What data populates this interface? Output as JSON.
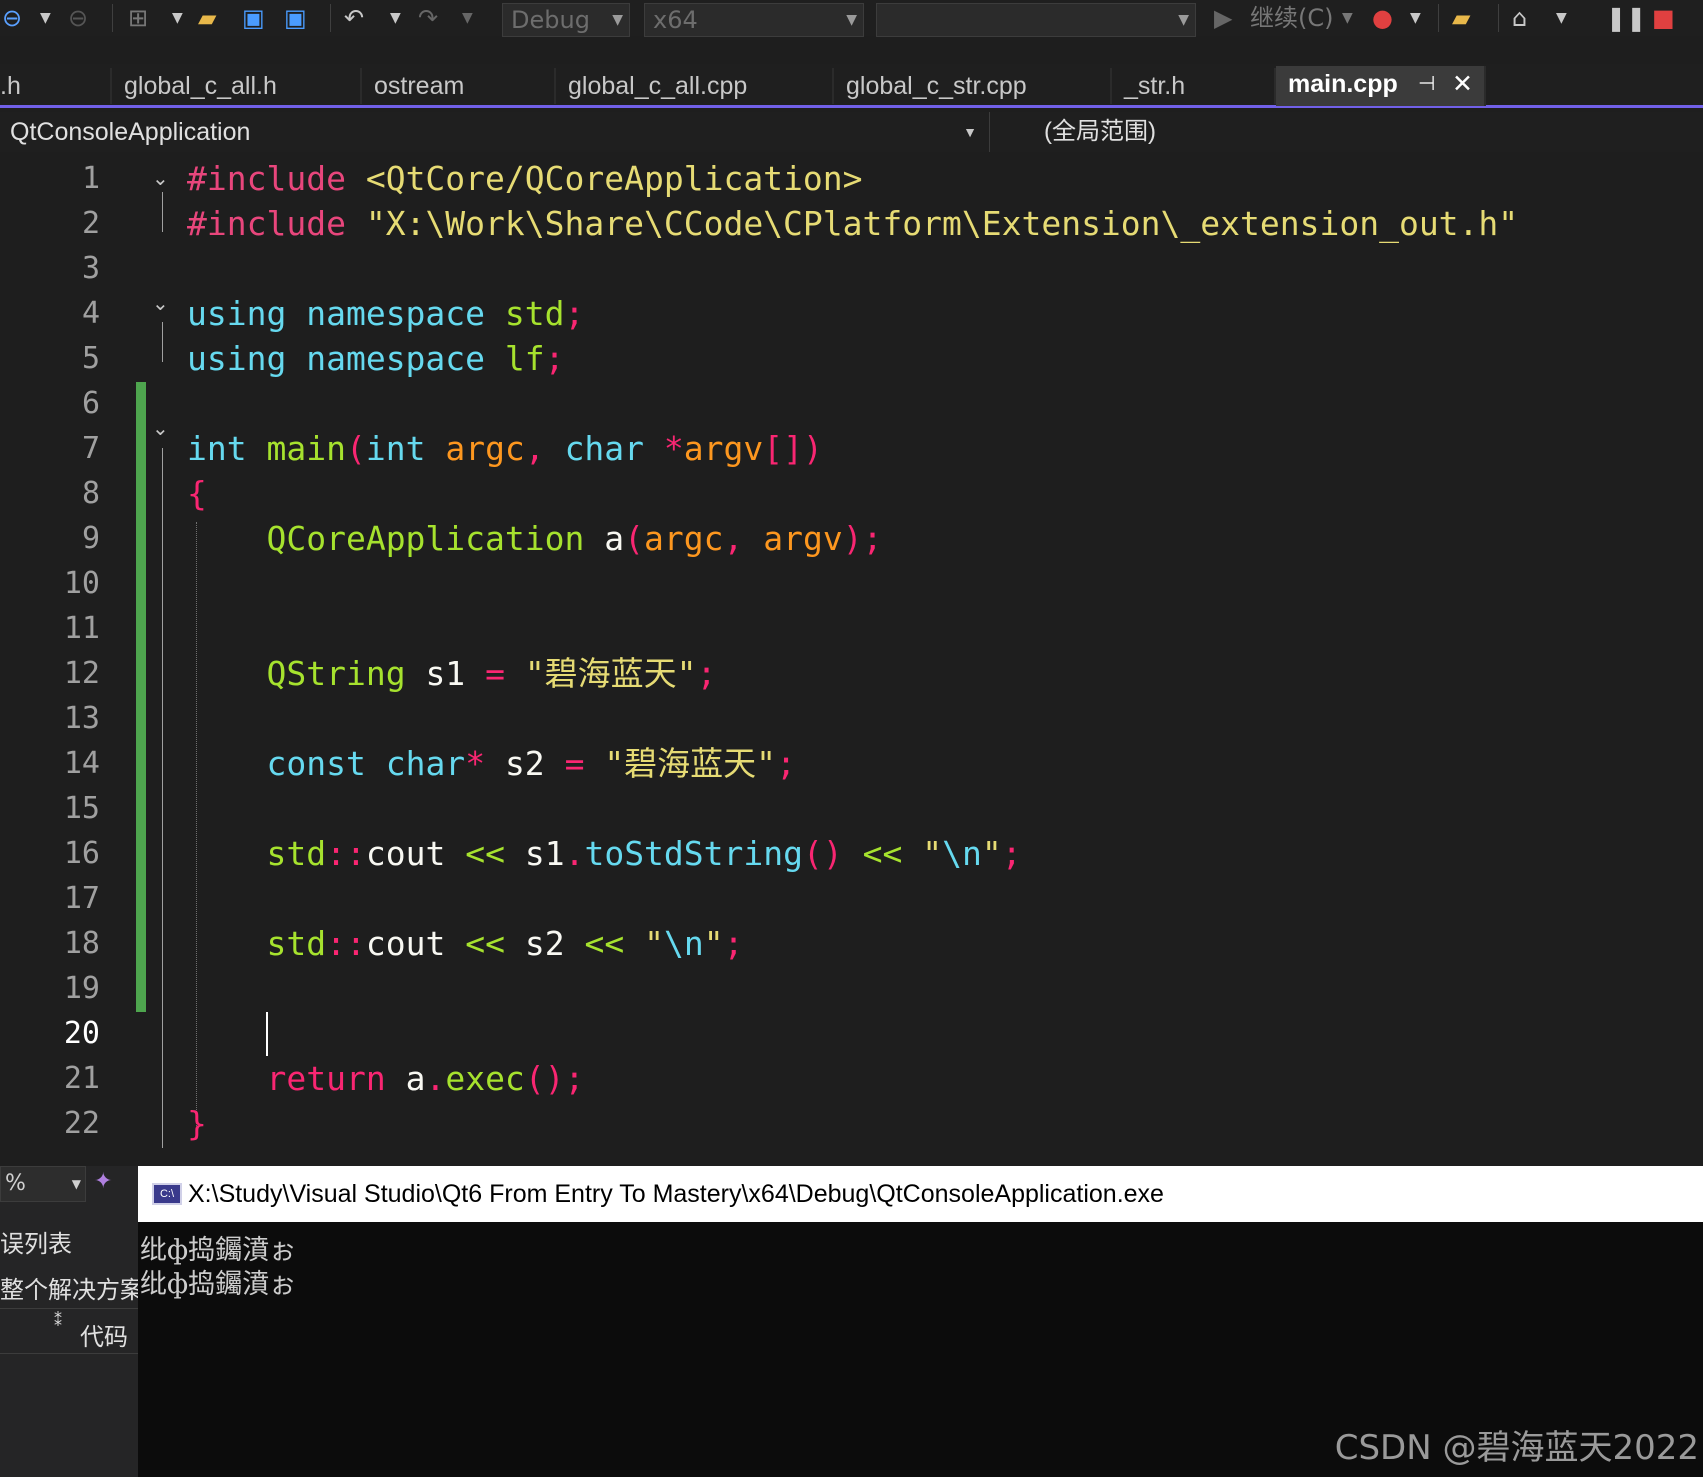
{
  "toolbar": {
    "config": "Debug",
    "platform": "x64",
    "startup": "",
    "continue_label": "继续(C)"
  },
  "tabs": [
    {
      "label": ".h"
    },
    {
      "label": "global_c_all.h"
    },
    {
      "label": "ostream"
    },
    {
      "label": "global_c_all.cpp"
    },
    {
      "label": "global_c_str.cpp"
    },
    {
      "label": "_str.h"
    },
    {
      "label": "main.cpp",
      "active": true
    }
  ],
  "navbar": {
    "project": "QtConsoleApplication",
    "scope": "(全局范围)"
  },
  "editor": {
    "line_numbers": [
      "1",
      "2",
      "3",
      "4",
      "5",
      "6",
      "7",
      "8",
      "9",
      "10",
      "11",
      "12",
      "13",
      "14",
      "15",
      "16",
      "17",
      "18",
      "19",
      "20",
      "21",
      "22"
    ],
    "current_line": "20",
    "lines": {
      "l1": {
        "a": "#include",
        "b": "<QtCore/QCoreApplication>"
      },
      "l2": {
        "a": "#include",
        "b": "\"X:\\Work\\Share\\CCode\\CPlatform\\Extension\\_extension_out.h\""
      },
      "l4": {
        "a": "using",
        "b": "namespace",
        "c": "std",
        "d": ";"
      },
      "l5": {
        "a": "using",
        "b": "namespace",
        "c": "lf",
        "d": ";"
      },
      "l7": {
        "a": "int",
        "b": "main",
        "c": "(",
        "d": "int",
        "e": "argc",
        "f": ",",
        "g": "char",
        "h": "*",
        "i": "argv",
        "j": "[])"
      },
      "l8": {
        "a": "{"
      },
      "l9": {
        "a": "QCoreApplication",
        "b": "a",
        "c": "(",
        "d": "argc",
        "e": ",",
        "f": "argv",
        "g": ");"
      },
      "l12": {
        "a": "QString",
        "b": "s1",
        "c": "=",
        "d": "\"碧海蓝天\"",
        "e": ";"
      },
      "l14": {
        "a": "const",
        "b": "char",
        "c": "*",
        "d": "s2",
        "e": "=",
        "f": "\"碧海蓝天\"",
        "g": ";"
      },
      "l16": {
        "a": "std",
        "b": "::",
        "c": "cout",
        "d": "<<",
        "e": "s1",
        "f": ".",
        "g": "toStdString",
        "h": "()",
        "i": "<<",
        "j": "\"",
        "k": "\\n",
        "l": "\"",
        "m": ";"
      },
      "l18": {
        "a": "std",
        "b": "::",
        "c": "cout",
        "d": "<<",
        "e": "s2",
        "f": "<<",
        "g": "\"",
        "h": "\\n",
        "i": "\"",
        "j": ";"
      },
      "l21": {
        "a": "return",
        "b": "a",
        "c": ".",
        "d": "exec",
        "e": "();"
      },
      "l22": {
        "a": "}"
      }
    }
  },
  "lower_left": {
    "zoom": "%",
    "error_list": "误列表",
    "solution": "整个解决方案",
    "code_header": "代码"
  },
  "console": {
    "title": "X:\\Study\\Visual Studio\\Qt6 From Entry To Mastery\\x64\\Debug\\QtConsoleApplication.exe",
    "output": [
      "纰ф捣钃濆ぉ",
      "纰ф捣钃濆ぉ"
    ]
  },
  "watermark": "CSDN @碧海蓝天2022"
}
